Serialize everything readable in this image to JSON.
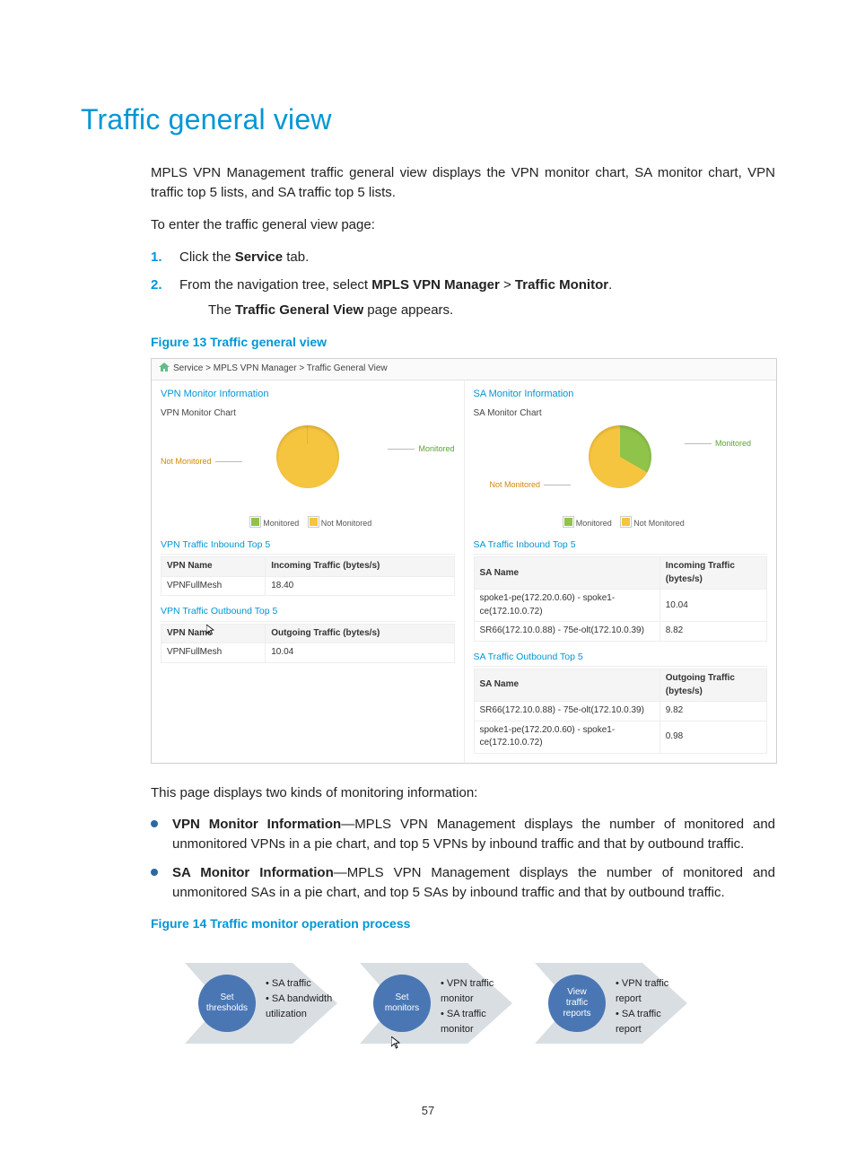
{
  "page_number": "57",
  "heading": "Traffic general view",
  "intro": "MPLS VPN Management traffic general view displays the VPN monitor chart, SA monitor chart, VPN traffic top 5 lists, and SA traffic top 5 lists.",
  "lead": "To enter the traffic general view page:",
  "steps": {
    "s1": {
      "num": "1.",
      "pre": "Click the ",
      "b": "Service",
      "post": " tab."
    },
    "s2": {
      "num": "2.",
      "pre": "From the navigation tree, select ",
      "b1": "MPLS VPN Manager",
      "sep": " > ",
      "b2": "Traffic Monitor",
      "post": ".",
      "sub_pre": "The ",
      "sub_b": "Traffic General View",
      "sub_post": " page appears."
    }
  },
  "fig13": "Figure 13 Traffic general view",
  "screenshot": {
    "breadcrumb": "Service > MPLS VPN Manager > Traffic General View",
    "left": {
      "title": "VPN Monitor Information",
      "chart_label": "VPN Monitor Chart",
      "not_mon": "Not Monitored",
      "mon": "Monitored",
      "legend_m": "Monitored",
      "legend_nm": "Not Monitored",
      "sec_in": "VPN Traffic Inbound Top 5",
      "th_in_1": "VPN Name",
      "th_in_2": "Incoming Traffic (bytes/s)",
      "row_in_1": "VPNFullMesh",
      "row_in_1v": "18.40",
      "sec_out": "VPN Traffic Outbound Top 5",
      "th_out_1": "VPN Name",
      "th_out_2": "Outgoing Traffic (bytes/s)",
      "row_out_1": "VPNFullMesh",
      "row_out_1v": "10.04"
    },
    "right": {
      "title": "SA Monitor Information",
      "chart_label": "SA Monitor Chart",
      "not_mon": "Not Monitored",
      "mon": "Monitored",
      "legend_m": "Monitored",
      "legend_nm": "Not Monitored",
      "sec_in": "SA Traffic Inbound Top 5",
      "th_in_1": "SA Name",
      "th_in_2": "Incoming Traffic (bytes/s)",
      "r_in_1": "spoke1-pe(172.20.0.60) - spoke1-ce(172.10.0.72)",
      "r_in_1v": "10.04",
      "r_in_2": "SR66(172.10.0.88) - 75e-olt(172.10.0.39)",
      "r_in_2v": "8.82",
      "sec_out": "SA Traffic Outbound Top 5",
      "th_out_1": "SA Name",
      "th_out_2": "Outgoing Traffic (bytes/s)",
      "r_out_1": "SR66(172.10.0.88) - 75e-olt(172.10.0.39)",
      "r_out_1v": "9.82",
      "r_out_2": "spoke1-pe(172.20.0.60) - spoke1-ce(172.10.0.72)",
      "r_out_2v": "0.98"
    }
  },
  "after_ss": "This page displays two kinds of monitoring information:",
  "bul1": {
    "b": "VPN Monitor Information",
    "rest": "—MPLS VPN Management displays the number of monitored and unmonitored VPNs in a pie chart, and top 5 VPNs by inbound traffic and that by outbound traffic."
  },
  "bul2": {
    "b": "SA Monitor Information",
    "rest": "—MPLS VPN Management displays the number of monitored and unmonitored SAs in a pie chart, and top 5 SAs by inbound traffic and that by outbound traffic."
  },
  "fig14": "Figure 14 Traffic monitor operation process",
  "process": {
    "s1": {
      "circle": "Set\nthresholds",
      "b1": "SA traffic",
      "b2": "SA bandwidth\nutilization"
    },
    "s2": {
      "circle": "Set\nmonitors",
      "b1": "VPN traffic\nmonitor",
      "b2": "SA traffic\nmonitor"
    },
    "s3": {
      "circle": "View\ntraffic\nreports",
      "b1": "VPN traffic\nreport",
      "b2": "SA traffic\nreport"
    }
  },
  "chart_data": [
    {
      "type": "pie",
      "title": "VPN Monitor Chart",
      "series": [
        {
          "name": "Monitored",
          "value": 1
        },
        {
          "name": "Not Monitored",
          "value": 99
        }
      ]
    },
    {
      "type": "pie",
      "title": "SA Monitor Chart",
      "series": [
        {
          "name": "Monitored",
          "value": 33
        },
        {
          "name": "Not Monitored",
          "value": 67
        }
      ]
    },
    {
      "type": "table",
      "title": "VPN Traffic Inbound Top 5",
      "columns": [
        "VPN Name",
        "Incoming Traffic (bytes/s)"
      ],
      "rows": [
        [
          "VPNFullMesh",
          18.4
        ]
      ]
    },
    {
      "type": "table",
      "title": "VPN Traffic Outbound Top 5",
      "columns": [
        "VPN Name",
        "Outgoing Traffic (bytes/s)"
      ],
      "rows": [
        [
          "VPNFullMesh",
          10.04
        ]
      ]
    },
    {
      "type": "table",
      "title": "SA Traffic Inbound Top 5",
      "columns": [
        "SA Name",
        "Incoming Traffic (bytes/s)"
      ],
      "rows": [
        [
          "spoke1-pe(172.20.0.60) - spoke1-ce(172.10.0.72)",
          10.04
        ],
        [
          "SR66(172.10.0.88) - 75e-olt(172.10.0.39)",
          8.82
        ]
      ]
    },
    {
      "type": "table",
      "title": "SA Traffic Outbound Top 5",
      "columns": [
        "SA Name",
        "Outgoing Traffic (bytes/s)"
      ],
      "rows": [
        [
          "SR66(172.10.0.88) - 75e-olt(172.10.0.39)",
          9.82
        ],
        [
          "spoke1-pe(172.20.0.60) - spoke1-ce(172.10.0.72)",
          0.98
        ]
      ]
    }
  ]
}
